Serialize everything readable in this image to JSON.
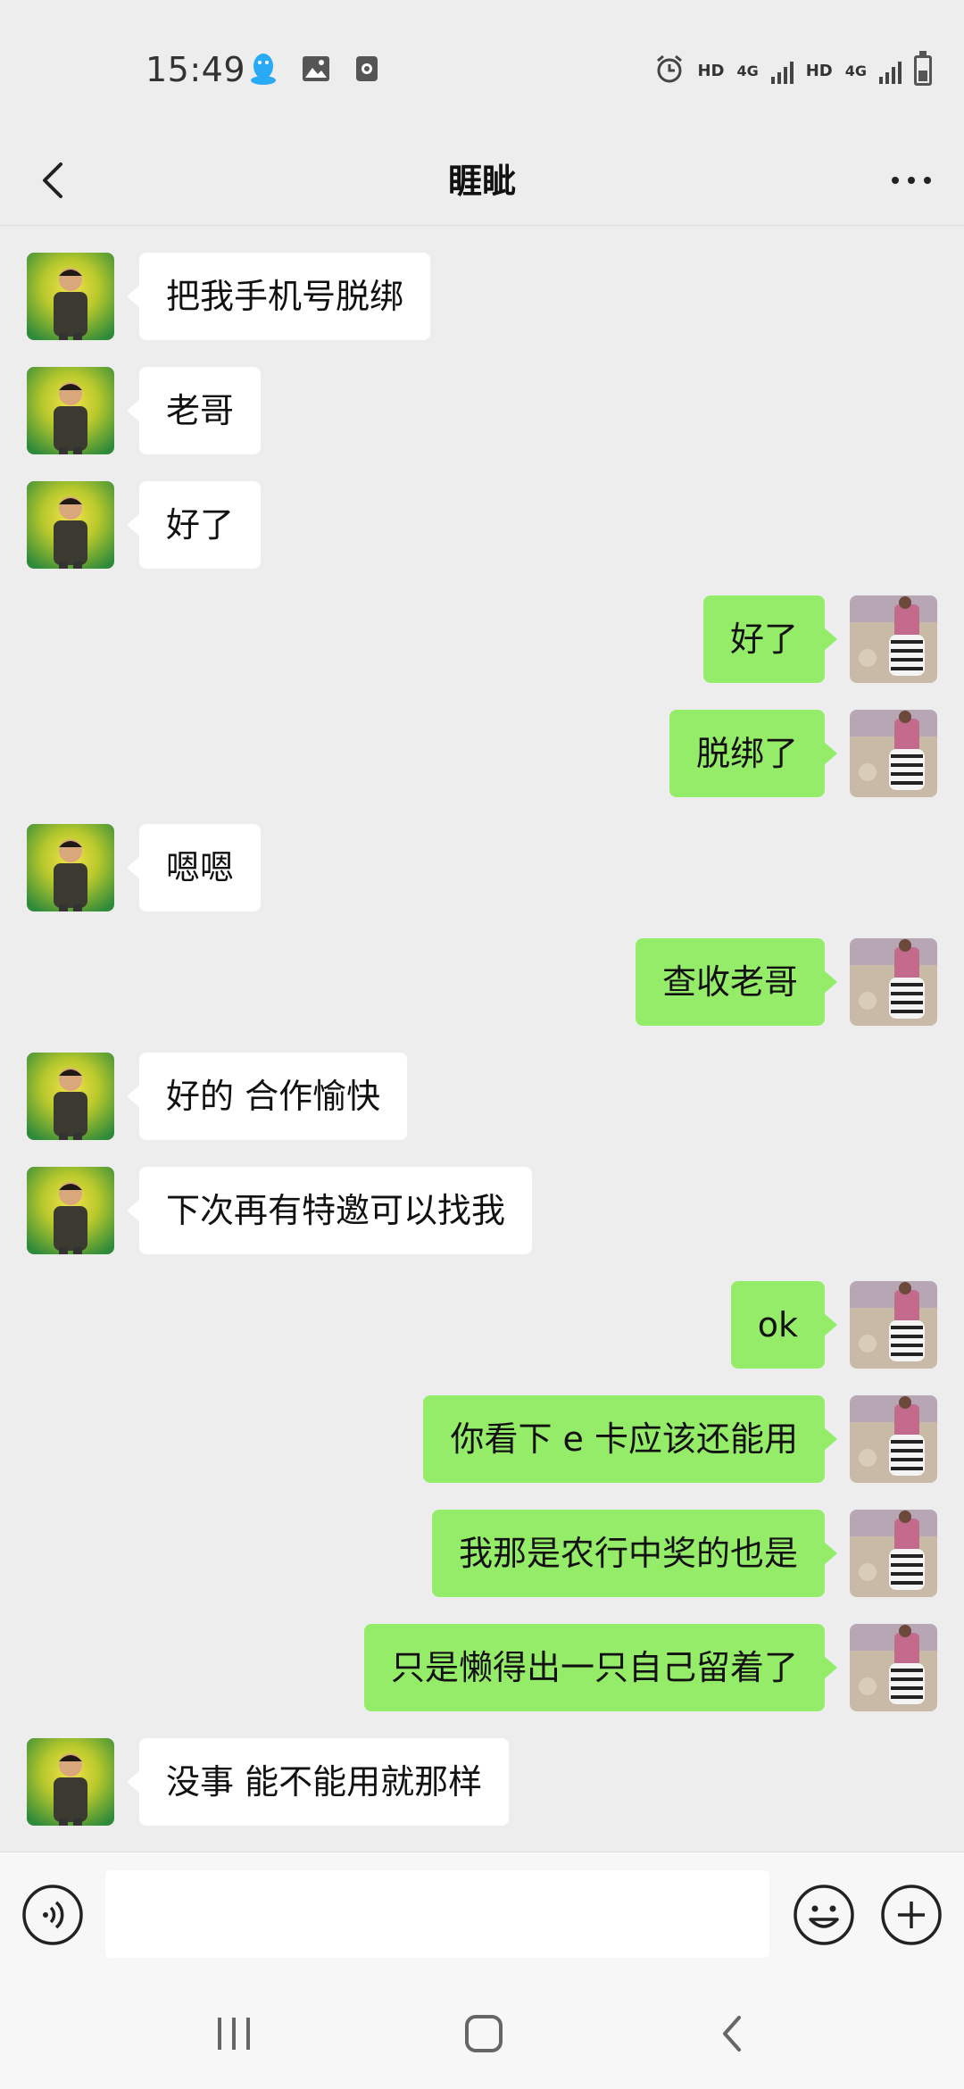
{
  "status_bar": {
    "time": "15:49",
    "left_icons": [
      "qq-penguin-icon",
      "gallery-icon",
      "camera-app-icon"
    ],
    "hd1": "HD",
    "net1": "4G",
    "hd2": "HD",
    "net2": "4G",
    "right_icons": [
      "alarm-icon",
      "signal-icon",
      "battery-icon"
    ]
  },
  "header": {
    "title": "睚眦",
    "back_icon": "chevron-left-icon",
    "more_icon": "more-dots-icon"
  },
  "messages": [
    {
      "side": "left",
      "text": "把我手机号脱绑"
    },
    {
      "side": "left",
      "text": "老哥"
    },
    {
      "side": "left",
      "text": "好了"
    },
    {
      "side": "right",
      "text": "好了"
    },
    {
      "side": "right",
      "text": "脱绑了"
    },
    {
      "side": "left",
      "text": "嗯嗯"
    },
    {
      "side": "right",
      "text": "查收老哥"
    },
    {
      "side": "left",
      "text": "好的 合作愉快"
    },
    {
      "side": "left",
      "text": "下次再有特邀可以找我"
    },
    {
      "side": "right",
      "text": "ok"
    },
    {
      "side": "right",
      "text": "你看下 e 卡应该还能用"
    },
    {
      "side": "right",
      "text": "我那是农行中奖的也是"
    },
    {
      "side": "right",
      "text": "只是懒得出一只自己留着了"
    },
    {
      "side": "left",
      "text": "没事 能不能用就那样"
    }
  ],
  "input_bar": {
    "value": "",
    "voice_icon": "voice-icon",
    "emoji_icon": "emoji-icon",
    "plus_icon": "plus-icon"
  },
  "nav_bar": {
    "icons": [
      "recent-apps-icon",
      "home-icon",
      "back-icon"
    ]
  },
  "colors": {
    "background": "#ededed",
    "sent_bubble": "#95ec69",
    "received_bubble": "#ffffff"
  }
}
